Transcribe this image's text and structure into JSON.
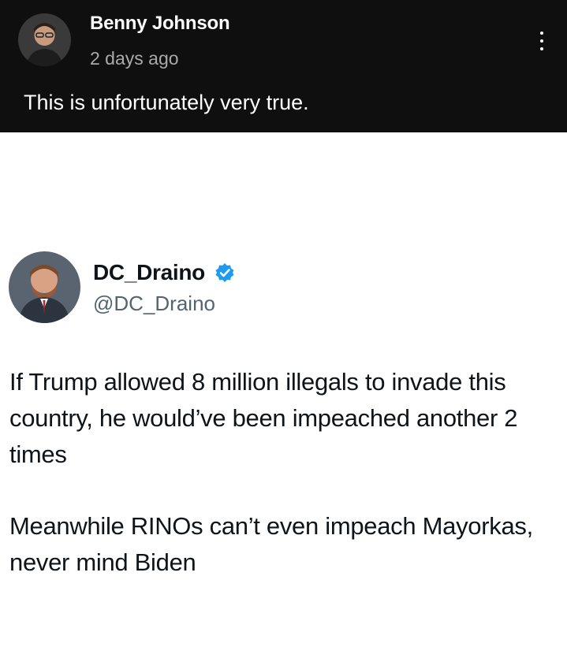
{
  "post": {
    "author": "Benny Johnson",
    "time": "2 days ago",
    "text": "This is unfortunately very true."
  },
  "tweet": {
    "name": "DC_Draino",
    "handle": "@DC_Draino",
    "paragraphs": [
      "If Trump allowed 8 million illegals to invade this country, he would’ve been impeached another 2 times",
      "Meanwhile RINOs can’t even impeach Mayorkas, never mind Biden"
    ]
  },
  "colors": {
    "header_bg": "#0f0f0f",
    "verified_blue": "#1d9bf0"
  },
  "icons": [
    "more-vert-icon",
    "verified-badge-icon"
  ]
}
